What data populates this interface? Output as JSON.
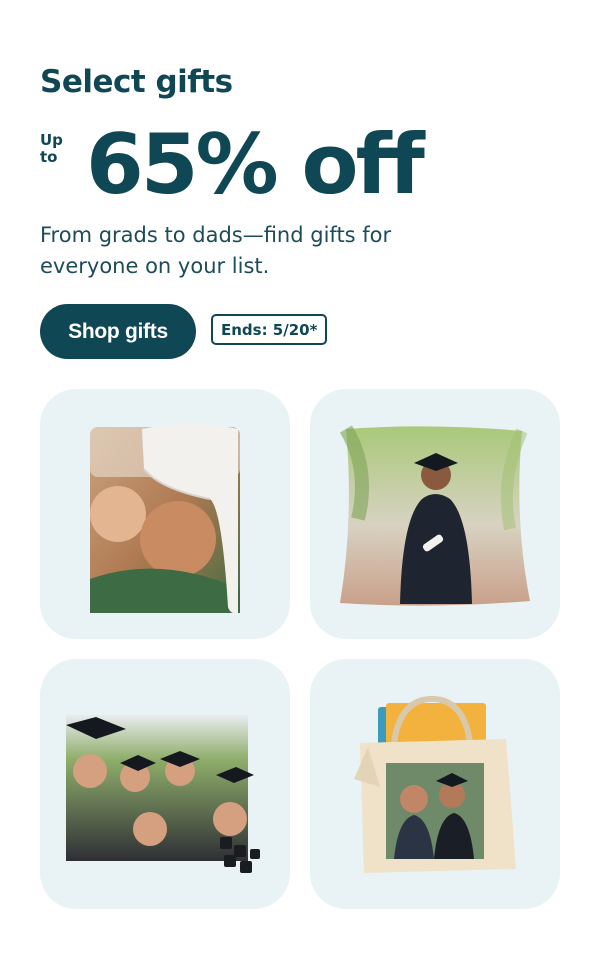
{
  "promo": {
    "eyebrow": "Select gifts",
    "up_to": "Up\nto",
    "headline": "65% off",
    "description": "From grads to dads—find gifts for everyone on your list.",
    "cta_label": "Shop gifts",
    "ends_label": "Ends: 5/20*"
  },
  "products": [
    {
      "name": "photo-blanket",
      "icon": "blanket-photo"
    },
    {
      "name": "photo-pillow",
      "icon": "pillow-photo"
    },
    {
      "name": "photo-puzzle",
      "icon": "puzzle-photo"
    },
    {
      "name": "photo-tote-bag",
      "icon": "tote-photo"
    }
  ],
  "colors": {
    "brand": "#0f4754",
    "tile_background": "#e9f2f4",
    "button_text": "#ffffff"
  }
}
